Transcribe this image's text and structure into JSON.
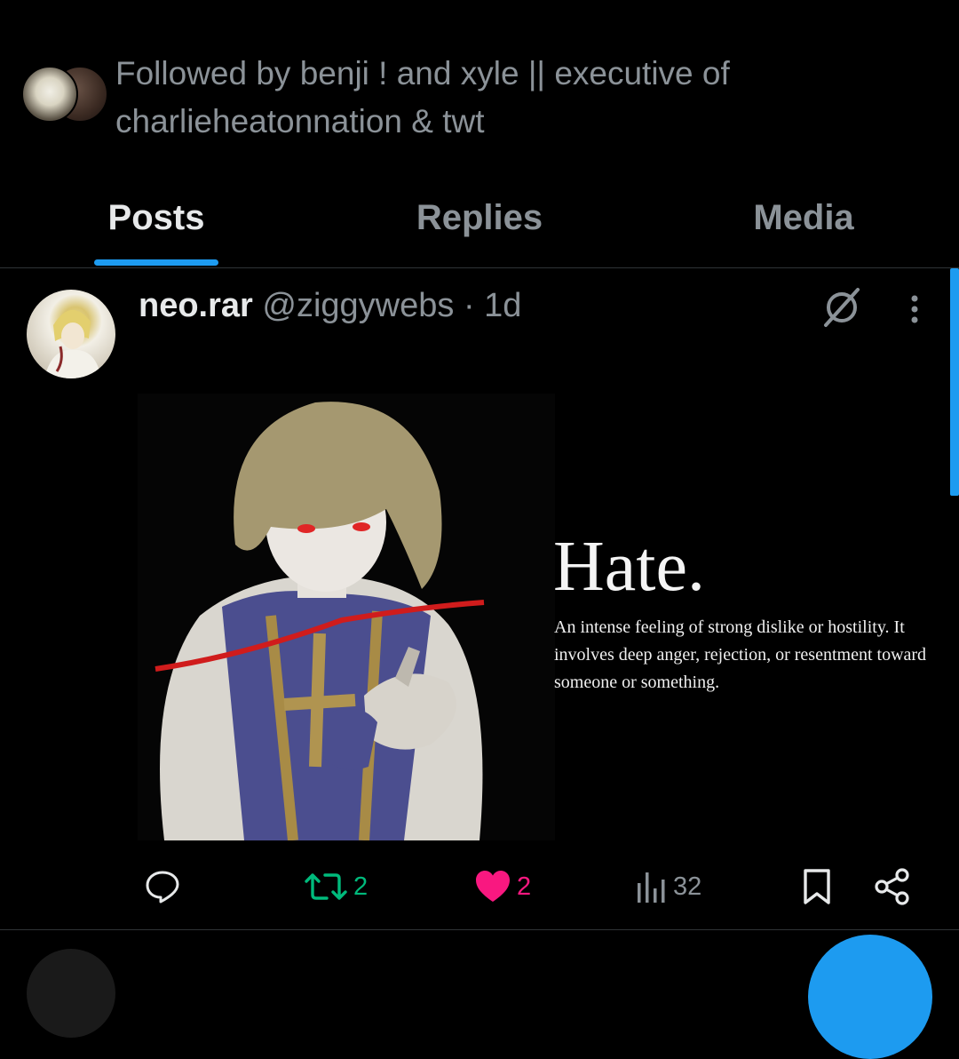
{
  "followed": {
    "text": "Followed by benji ! and xyle || executive of charlieheatonnation & twt"
  },
  "tabs": [
    {
      "label": "Posts",
      "active": true
    },
    {
      "label": "Replies",
      "active": false
    },
    {
      "label": "Media",
      "active": false
    }
  ],
  "post": {
    "author_name": "neo.rar",
    "author_meta": "@ziggywebs · 1d",
    "media": {
      "title": "Hate.",
      "definition": "An intense feeling of strong dislike or hostility. It involves deep anger, rejection, or resentment toward someone or something."
    },
    "actions": {
      "reposts": "2",
      "likes": "2",
      "views": "32"
    }
  },
  "colors": {
    "accent": "#1d9bf0",
    "repost": "#00ba7c",
    "like": "#f91880",
    "muted": "#8b9298"
  },
  "icons": {
    "grok": "grok-icon",
    "more": "more-vertical-icon",
    "reply": "reply-icon",
    "repost": "repost-icon",
    "like": "heart-filled-icon",
    "views": "views-icon",
    "bookmark": "bookmark-icon",
    "share": "share-icon"
  }
}
